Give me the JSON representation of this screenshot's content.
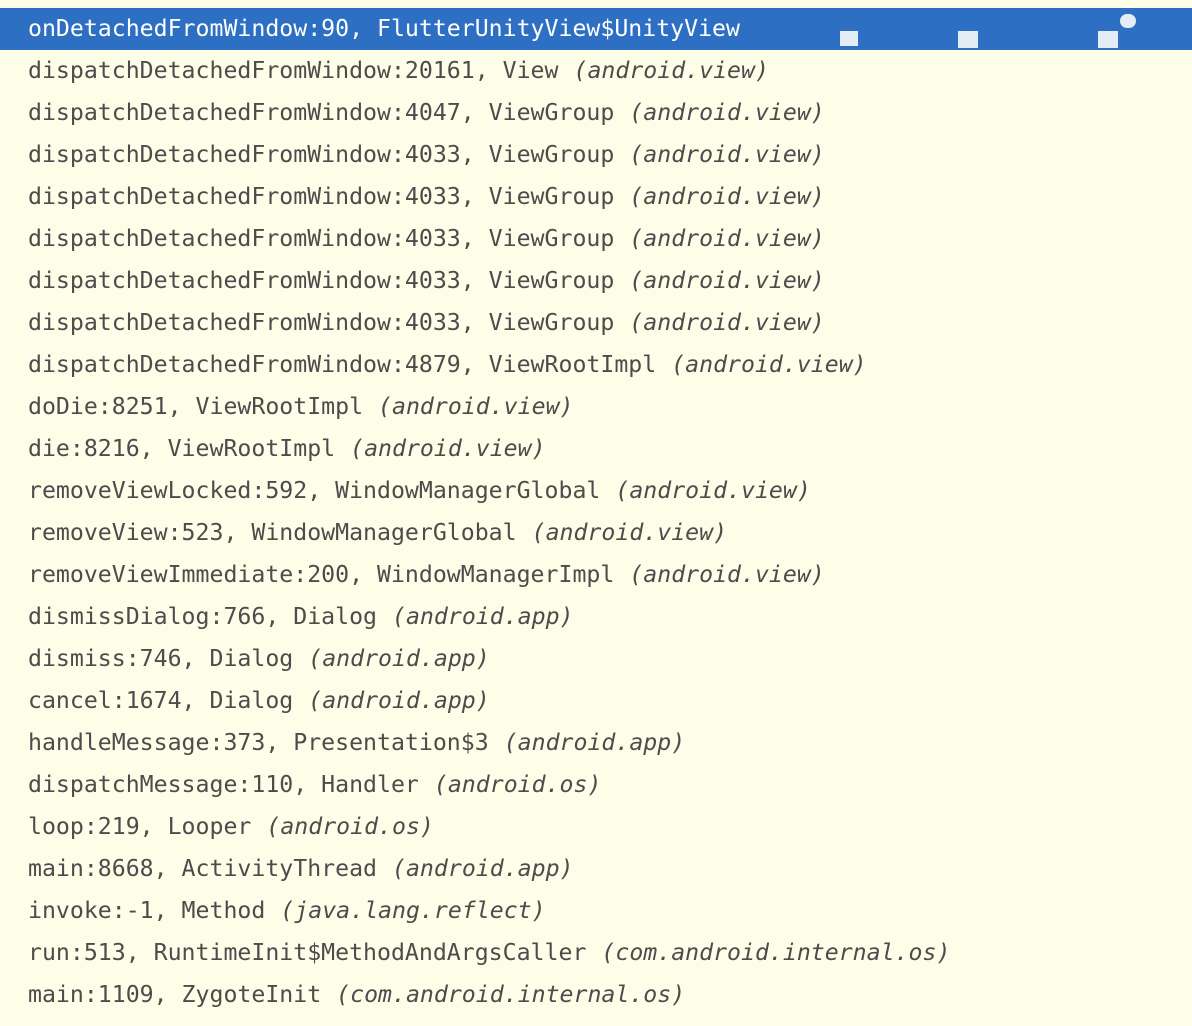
{
  "frames": [
    {
      "method": "onDetachedFromWindow:90, FlutterUnityView$UnityView",
      "package": "",
      "selected": true
    },
    {
      "method": "dispatchDetachedFromWindow:20161, View",
      "package": "(android.view)"
    },
    {
      "method": "dispatchDetachedFromWindow:4047, ViewGroup",
      "package": "(android.view)"
    },
    {
      "method": "dispatchDetachedFromWindow:4033, ViewGroup",
      "package": "(android.view)"
    },
    {
      "method": "dispatchDetachedFromWindow:4033, ViewGroup",
      "package": "(android.view)"
    },
    {
      "method": "dispatchDetachedFromWindow:4033, ViewGroup",
      "package": "(android.view)"
    },
    {
      "method": "dispatchDetachedFromWindow:4033, ViewGroup",
      "package": "(android.view)"
    },
    {
      "method": "dispatchDetachedFromWindow:4033, ViewGroup",
      "package": "(android.view)"
    },
    {
      "method": "dispatchDetachedFromWindow:4879, ViewRootImpl",
      "package": "(android.view)"
    },
    {
      "method": "doDie:8251, ViewRootImpl",
      "package": "(android.view)"
    },
    {
      "method": "die:8216, ViewRootImpl",
      "package": "(android.view)"
    },
    {
      "method": "removeViewLocked:592, WindowManagerGlobal",
      "package": "(android.view)"
    },
    {
      "method": "removeView:523, WindowManagerGlobal",
      "package": "(android.view)"
    },
    {
      "method": "removeViewImmediate:200, WindowManagerImpl",
      "package": "(android.view)"
    },
    {
      "method": "dismissDialog:766, Dialog",
      "package": "(android.app)"
    },
    {
      "method": "dismiss:746, Dialog",
      "package": "(android.app)"
    },
    {
      "method": "cancel:1674, Dialog",
      "package": "(android.app)"
    },
    {
      "method": "handleMessage:373, Presentation$3",
      "package": "(android.app)"
    },
    {
      "method": "dispatchMessage:110, Handler",
      "package": "(android.os)"
    },
    {
      "method": "loop:219, Looper",
      "package": "(android.os)"
    },
    {
      "method": "main:8668, ActivityThread",
      "package": "(android.app)"
    },
    {
      "method": "invoke:-1, Method",
      "package": "(java.lang.reflect)"
    },
    {
      "method": "run:513, RuntimeInit$MethodAndArgsCaller",
      "package": "(com.android.internal.os)"
    },
    {
      "method": "main:1109, ZygoteInit",
      "package": "(com.android.internal.os)"
    }
  ],
  "colors": {
    "background": "#fdfde8",
    "selected_background": "#2c6fc3",
    "selected_text": "#ffffff",
    "text": "#4c4c4c"
  }
}
